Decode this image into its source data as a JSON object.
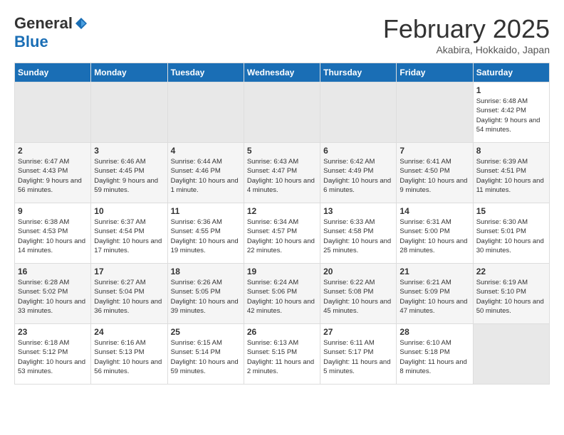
{
  "header": {
    "logo_general": "General",
    "logo_blue": "Blue",
    "title": "February 2025",
    "location": "Akabira, Hokkaido, Japan"
  },
  "days_of_week": [
    "Sunday",
    "Monday",
    "Tuesday",
    "Wednesday",
    "Thursday",
    "Friday",
    "Saturday"
  ],
  "weeks": [
    [
      {
        "day": "",
        "info": ""
      },
      {
        "day": "",
        "info": ""
      },
      {
        "day": "",
        "info": ""
      },
      {
        "day": "",
        "info": ""
      },
      {
        "day": "",
        "info": ""
      },
      {
        "day": "",
        "info": ""
      },
      {
        "day": "1",
        "info": "Sunrise: 6:48 AM\nSunset: 4:42 PM\nDaylight: 9 hours and 54 minutes."
      }
    ],
    [
      {
        "day": "2",
        "info": "Sunrise: 6:47 AM\nSunset: 4:43 PM\nDaylight: 9 hours and 56 minutes."
      },
      {
        "day": "3",
        "info": "Sunrise: 6:46 AM\nSunset: 4:45 PM\nDaylight: 9 hours and 59 minutes."
      },
      {
        "day": "4",
        "info": "Sunrise: 6:44 AM\nSunset: 4:46 PM\nDaylight: 10 hours and 1 minute."
      },
      {
        "day": "5",
        "info": "Sunrise: 6:43 AM\nSunset: 4:47 PM\nDaylight: 10 hours and 4 minutes."
      },
      {
        "day": "6",
        "info": "Sunrise: 6:42 AM\nSunset: 4:49 PM\nDaylight: 10 hours and 6 minutes."
      },
      {
        "day": "7",
        "info": "Sunrise: 6:41 AM\nSunset: 4:50 PM\nDaylight: 10 hours and 9 minutes."
      },
      {
        "day": "8",
        "info": "Sunrise: 6:39 AM\nSunset: 4:51 PM\nDaylight: 10 hours and 11 minutes."
      }
    ],
    [
      {
        "day": "9",
        "info": "Sunrise: 6:38 AM\nSunset: 4:53 PM\nDaylight: 10 hours and 14 minutes."
      },
      {
        "day": "10",
        "info": "Sunrise: 6:37 AM\nSunset: 4:54 PM\nDaylight: 10 hours and 17 minutes."
      },
      {
        "day": "11",
        "info": "Sunrise: 6:36 AM\nSunset: 4:55 PM\nDaylight: 10 hours and 19 minutes."
      },
      {
        "day": "12",
        "info": "Sunrise: 6:34 AM\nSunset: 4:57 PM\nDaylight: 10 hours and 22 minutes."
      },
      {
        "day": "13",
        "info": "Sunrise: 6:33 AM\nSunset: 4:58 PM\nDaylight: 10 hours and 25 minutes."
      },
      {
        "day": "14",
        "info": "Sunrise: 6:31 AM\nSunset: 5:00 PM\nDaylight: 10 hours and 28 minutes."
      },
      {
        "day": "15",
        "info": "Sunrise: 6:30 AM\nSunset: 5:01 PM\nDaylight: 10 hours and 30 minutes."
      }
    ],
    [
      {
        "day": "16",
        "info": "Sunrise: 6:28 AM\nSunset: 5:02 PM\nDaylight: 10 hours and 33 minutes."
      },
      {
        "day": "17",
        "info": "Sunrise: 6:27 AM\nSunset: 5:04 PM\nDaylight: 10 hours and 36 minutes."
      },
      {
        "day": "18",
        "info": "Sunrise: 6:26 AM\nSunset: 5:05 PM\nDaylight: 10 hours and 39 minutes."
      },
      {
        "day": "19",
        "info": "Sunrise: 6:24 AM\nSunset: 5:06 PM\nDaylight: 10 hours and 42 minutes."
      },
      {
        "day": "20",
        "info": "Sunrise: 6:22 AM\nSunset: 5:08 PM\nDaylight: 10 hours and 45 minutes."
      },
      {
        "day": "21",
        "info": "Sunrise: 6:21 AM\nSunset: 5:09 PM\nDaylight: 10 hours and 47 minutes."
      },
      {
        "day": "22",
        "info": "Sunrise: 6:19 AM\nSunset: 5:10 PM\nDaylight: 10 hours and 50 minutes."
      }
    ],
    [
      {
        "day": "23",
        "info": "Sunrise: 6:18 AM\nSunset: 5:12 PM\nDaylight: 10 hours and 53 minutes."
      },
      {
        "day": "24",
        "info": "Sunrise: 6:16 AM\nSunset: 5:13 PM\nDaylight: 10 hours and 56 minutes."
      },
      {
        "day": "25",
        "info": "Sunrise: 6:15 AM\nSunset: 5:14 PM\nDaylight: 10 hours and 59 minutes."
      },
      {
        "day": "26",
        "info": "Sunrise: 6:13 AM\nSunset: 5:15 PM\nDaylight: 11 hours and 2 minutes."
      },
      {
        "day": "27",
        "info": "Sunrise: 6:11 AM\nSunset: 5:17 PM\nDaylight: 11 hours and 5 minutes."
      },
      {
        "day": "28",
        "info": "Sunrise: 6:10 AM\nSunset: 5:18 PM\nDaylight: 11 hours and 8 minutes."
      },
      {
        "day": "",
        "info": ""
      }
    ]
  ]
}
